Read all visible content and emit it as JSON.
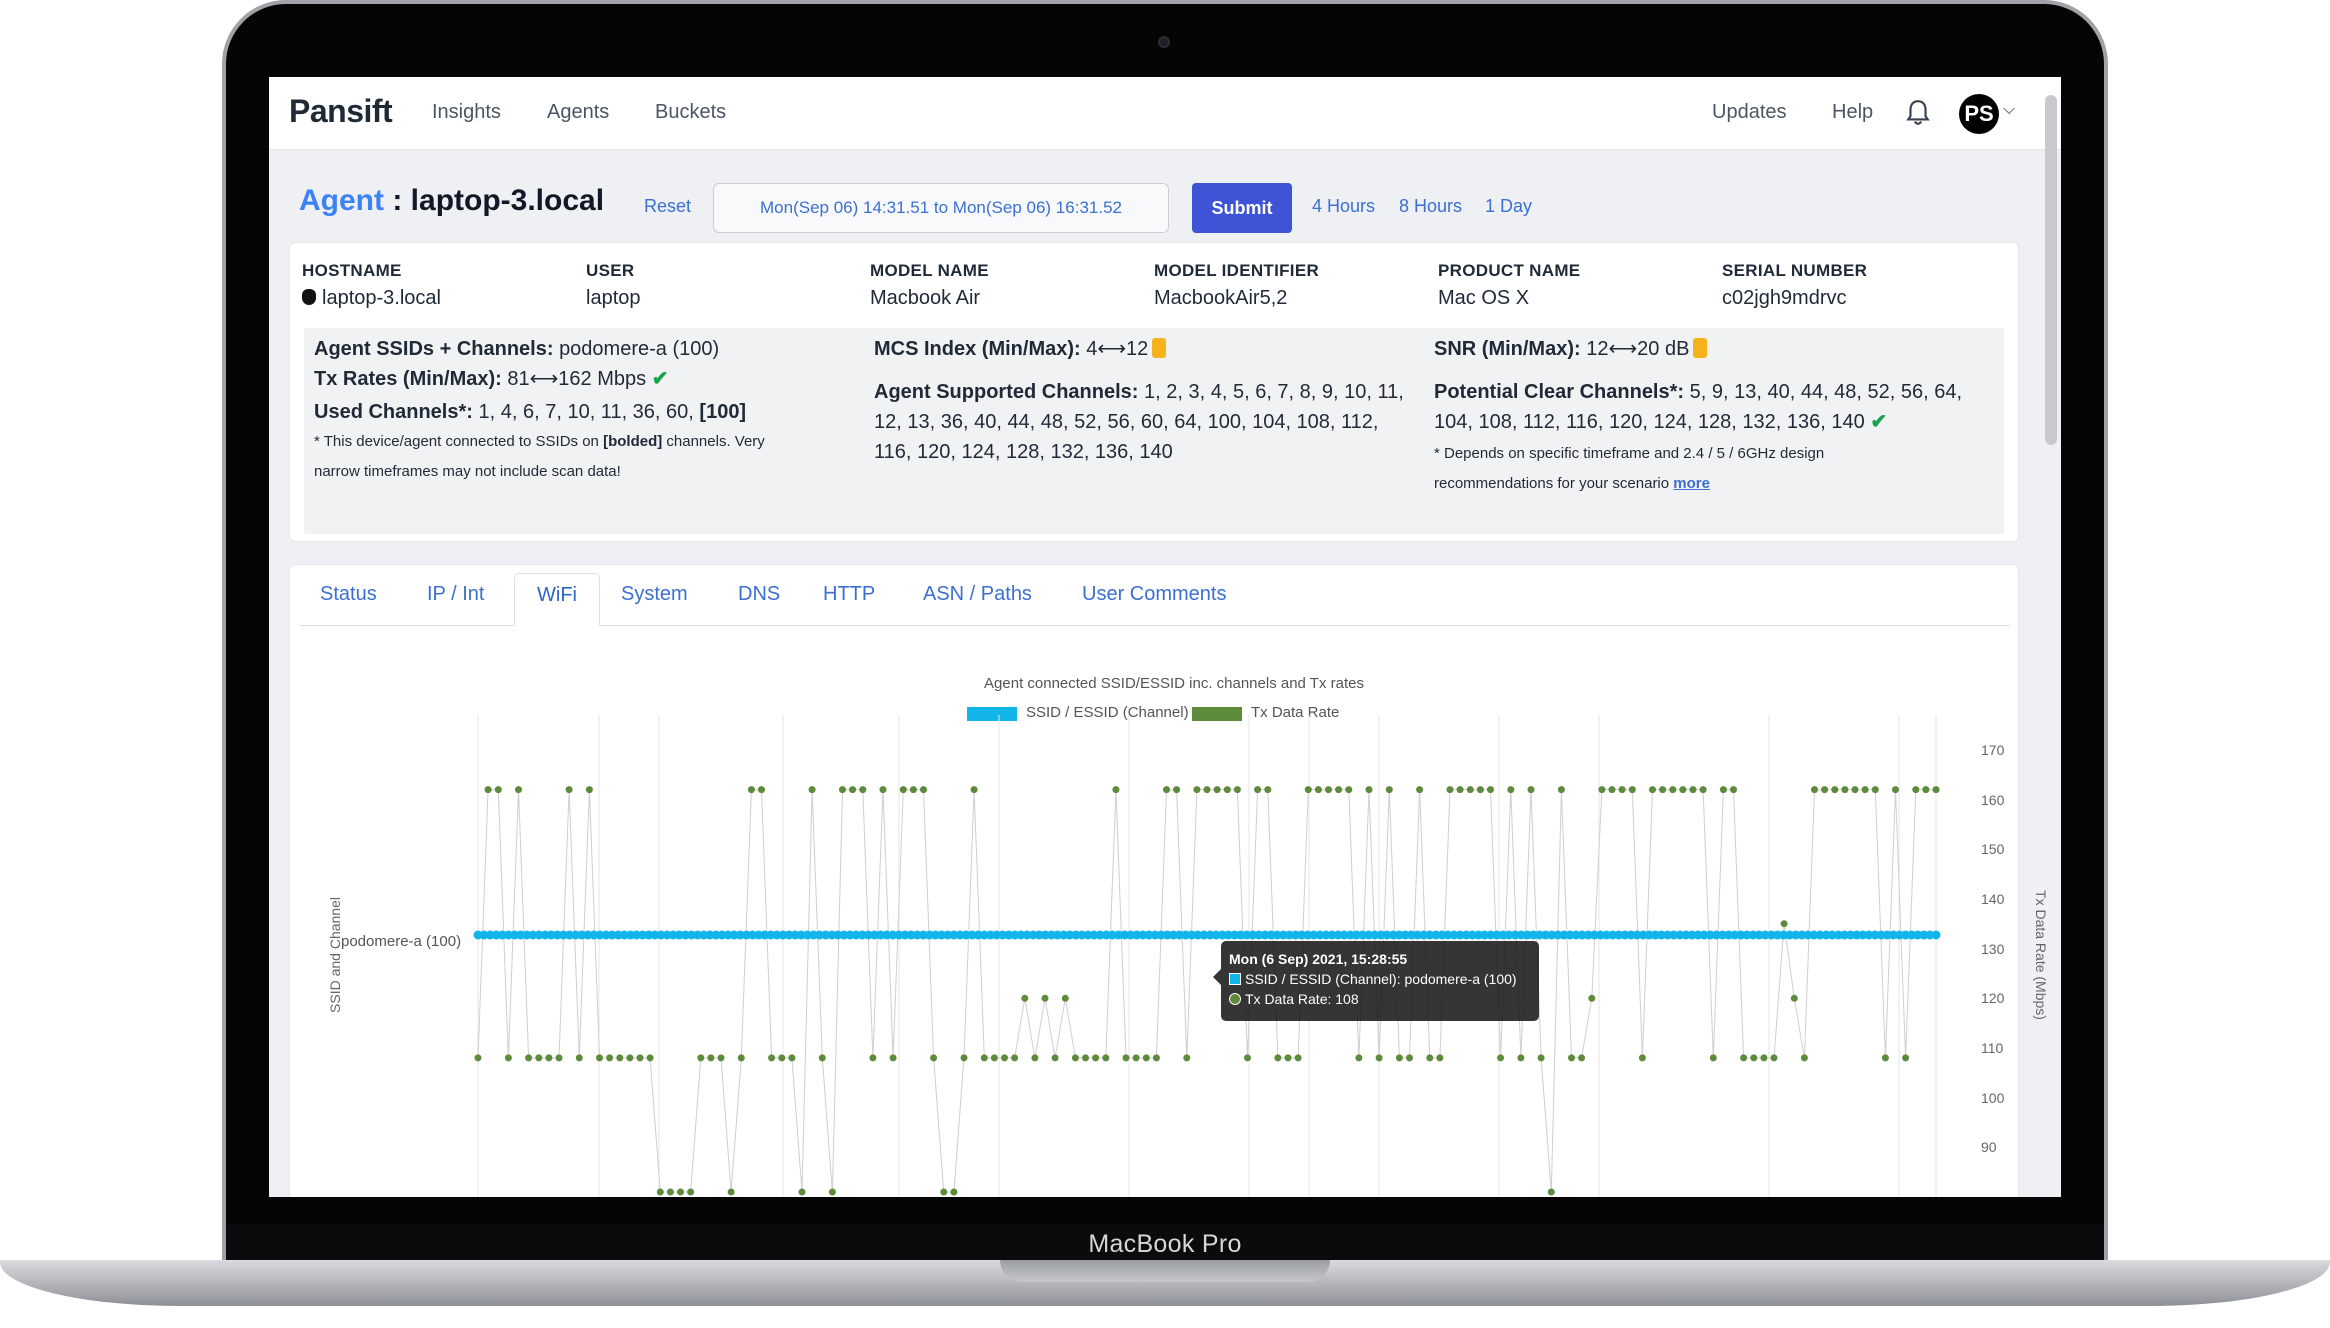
{
  "device": {
    "bottom_label": "MacBook Pro"
  },
  "nav": {
    "logo": "Pansift",
    "links": [
      "Insights",
      "Agents",
      "Buckets"
    ],
    "right_links": [
      "Updates",
      "Help"
    ],
    "avatar_initials": "PS"
  },
  "agent": {
    "label": "Agent",
    "separator": " : ",
    "name": "laptop-3.local",
    "reset": "Reset",
    "range_value": "Mon(Sep 06) 14:31.51 to Mon(Sep 06) 16:31.52",
    "submit": "Submit",
    "quick_ranges": [
      "4 Hours",
      "8 Hours",
      "1 Day"
    ]
  },
  "meta": [
    {
      "head": "HOSTNAME",
      "value": "laptop-3.local"
    },
    {
      "head": "USER",
      "value": "laptop"
    },
    {
      "head": "MODEL NAME",
      "value": "Macbook Air"
    },
    {
      "head": "MODEL IDENTIFIER",
      "value": "MacbookAir5,2"
    },
    {
      "head": "PRODUCT NAME",
      "value": "Mac OS X"
    },
    {
      "head": "SERIAL NUMBER",
      "value": "c02jgh9mdrvc"
    }
  ],
  "stats": {
    "ssids_label": "Agent SSIDs + Channels:",
    "ssids_value": "podomere-a (100)",
    "tx_label": "Tx Rates (Min/Max):",
    "tx_value": "81⟷162 Mbps",
    "used_label": "Used Channels*:",
    "used_value": "1, 4, 6, 7, 10, 11, 36, 60,",
    "used_bold": "[100]",
    "used_note_1": "* This device/agent connected to SSIDs on",
    "used_note_bold": "[bolded]",
    "used_note_2": "channels. Very",
    "used_note_3": "narrow timeframes may not include scan data!",
    "mcs_label": "MCS Index (Min/Max):",
    "mcs_value": "4⟷12",
    "supported_label": "Agent Supported Channels:",
    "supported_line1": "1, 2, 3, 4, 5, 6, 7, 8, 9, 10, 11,",
    "supported_line2": "12, 13, 36, 40, 44, 48, 52, 56, 60, 64, 100, 104, 108, 112,",
    "supported_line3": "116, 120, 124, 128, 132, 136, 140",
    "snr_label": "SNR (Min/Max):",
    "snr_value": "12⟷20 dB",
    "clear_label": "Potential Clear Channels*:",
    "clear_line1": "5, 9, 13, 40, 44, 48, 52, 56, 64,",
    "clear_line2": "104, 108, 112, 116, 120, 124, 128, 132, 136, 140",
    "clear_note_1": "* Depends on specific timeframe and 2.4 / 5 / 6GHz design",
    "clear_note_2": "recommendations for your scenario",
    "clear_note_link": "more"
  },
  "tabs": [
    "Status",
    "IP / Int",
    "WiFi",
    "System",
    "DNS",
    "HTTP",
    "ASN / Paths",
    "User Comments"
  ],
  "active_tab": "WiFi",
  "colors": {
    "accent": "#3f53d6",
    "ssid_series": "#12b5ea",
    "tx_series": "#5e8a3c",
    "link": "#3b6fd1"
  },
  "chart_data": {
    "type": "scatter",
    "title": "Agent connected SSID/ESSID inc. channels and Tx rates",
    "series": [
      {
        "name": "SSID / ESSID (Channel)",
        "category": "podomere-a (100)",
        "point_count": 240
      },
      {
        "name": "Tx Data Rate",
        "values": [
          108,
          162,
          162,
          108,
          162,
          108,
          108,
          108,
          108,
          162,
          108,
          162,
          108,
          108,
          108,
          108,
          108,
          108,
          81,
          81,
          81,
          81,
          108,
          108,
          108,
          81,
          108,
          162,
          162,
          108,
          108,
          108,
          81,
          162,
          108,
          81,
          162,
          162,
          162,
          108,
          162,
          108,
          162,
          162,
          162,
          108,
          81,
          81,
          108,
          162,
          108,
          108,
          108,
          108,
          120,
          108,
          120,
          108,
          120,
          108,
          108,
          108,
          108,
          162,
          108,
          108,
          108,
          108,
          162,
          162,
          108,
          162,
          162,
          162,
          162,
          162,
          108,
          162,
          162,
          108,
          108,
          108,
          162,
          162,
          162,
          162,
          162,
          108,
          162,
          108,
          162,
          108,
          108,
          162,
          108,
          108,
          162,
          162,
          162,
          162,
          162,
          108,
          162,
          108,
          162,
          108,
          81,
          162,
          108,
          108,
          120,
          162,
          162,
          162,
          162,
          108,
          162,
          162,
          162,
          162,
          162,
          162,
          108,
          162,
          162,
          108,
          108,
          108,
          108,
          135,
          120,
          108,
          162,
          162,
          162,
          162,
          162,
          162,
          162,
          108,
          162,
          108,
          162,
          162,
          162
        ]
      }
    ],
    "y_left_label": "SSID and Channel",
    "y_left_categories": [
      "podomere-a (100)"
    ],
    "y_right_label": "Tx Data Rate (Mbps)",
    "y_right_ticks": [
      170,
      160,
      150,
      140,
      130,
      120,
      110,
      100,
      90
    ],
    "y_right_range": [
      80,
      175
    ],
    "grid": true,
    "legend": "top-center"
  },
  "tooltip": {
    "title": "Mon (6 Sep) 2021, 15:28:55",
    "row1": "SSID / ESSID (Channel): podomere-a (100)",
    "row2": "Tx Data Rate: 108"
  }
}
